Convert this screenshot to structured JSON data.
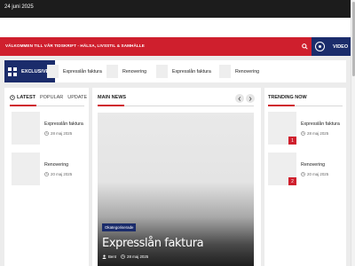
{
  "topbar": {
    "date": "24 juni 2025"
  },
  "nav": {
    "welcome": "VÄLKOMMEN TILL VÅR TIDSKRIFT - HÄLSA, LIVSSTIL & SAMHÄLLE",
    "video_label": "VIDEO"
  },
  "ticker": {
    "label": "EXCLUSIVE",
    "items": [
      "Expresslån faktura",
      "Renovering",
      "Expresslån faktura",
      "Renovering"
    ]
  },
  "left_panel": {
    "tabs": [
      "LATEST",
      "POPULAR",
      "UPDATE"
    ],
    "posts": [
      {
        "title": "Expresslån faktura",
        "date": "28 maj 2025"
      },
      {
        "title": "Renovering",
        "date": "20 maj 2025"
      }
    ]
  },
  "main_news": {
    "title": "MAIN NEWS",
    "hero": {
      "category": "Okategoriserade",
      "title": "Expresslån faktura",
      "author": "Bent",
      "date": "28 maj 2025"
    }
  },
  "trending": {
    "title": "TRENDING NOW",
    "posts": [
      {
        "rank": "1",
        "title": "Expresslån faktura",
        "date": "28 maj 2025"
      },
      {
        "rank": "2",
        "title": "Renovering",
        "date": "20 maj 2025"
      }
    ]
  },
  "colors": {
    "accent": "#cf1f2d",
    "navy": "#1b2c6b",
    "topbar": "#1c1c1c"
  }
}
